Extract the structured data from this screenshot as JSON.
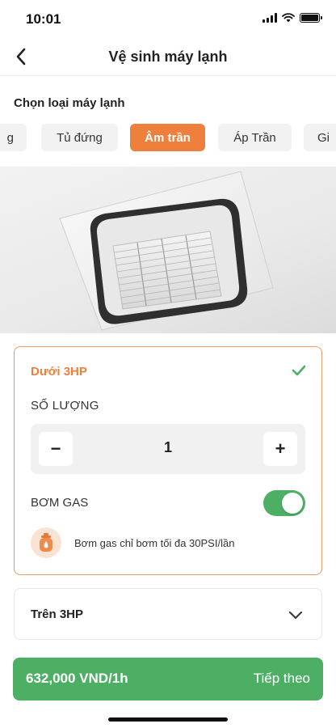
{
  "status": {
    "time": "10:01"
  },
  "header": {
    "title": "Vệ sinh máy lạnh",
    "back_icon": "chevron-left-icon"
  },
  "type_selector": {
    "label": "Chọn loại máy lạnh",
    "options": [
      "g",
      "Tủ đứng",
      "Âm trần",
      "Áp Trần",
      "Gi"
    ],
    "selected": "Âm trần",
    "accent_color": "#ee7f3c"
  },
  "hero": {
    "image": "ceiling cassette air conditioner"
  },
  "capacity_options": [
    {
      "title": "Dưới 3HP",
      "selected": true,
      "quantity_label": "SỐ LƯỢNG",
      "quantity": "1",
      "minus_label": "−",
      "plus_label": "+",
      "gas_label": "BƠM GAS",
      "gas_enabled": true,
      "gas_note": "Bơm gas chỉ bơm tối đa 30PSI/lần"
    },
    {
      "title": "Trên 3HP",
      "selected": false
    }
  ],
  "footer": {
    "price": "632,000 VND/1h",
    "next_label": "Tiếp theo",
    "button_color": "#4caf64"
  }
}
